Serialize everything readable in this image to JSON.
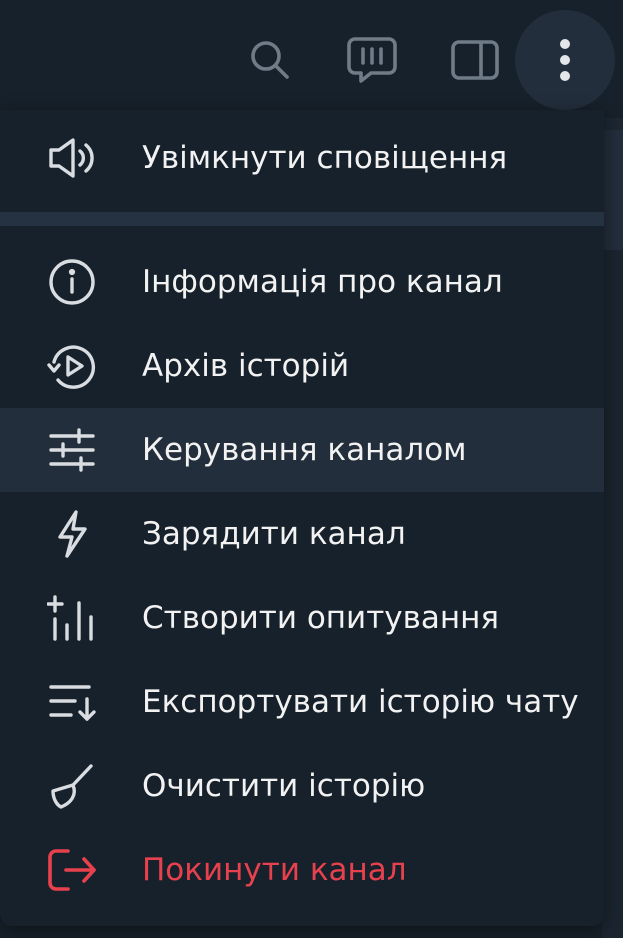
{
  "header": {
    "buttons": [
      {
        "id": "search",
        "icon": "search-icon"
      },
      {
        "id": "chat",
        "icon": "chat-icon"
      },
      {
        "id": "panel",
        "icon": "sidebar-toggle-icon"
      },
      {
        "id": "more",
        "icon": "more-vertical-icon"
      }
    ]
  },
  "menu": {
    "items": [
      {
        "label": "Увімкнути сповіщення",
        "icon": "speaker-icon"
      },
      {
        "label": "Інформація про канал",
        "icon": "info-icon"
      },
      {
        "label": "Архів історій",
        "icon": "stories-archive-icon"
      },
      {
        "label": "Керування каналом",
        "icon": "sliders-icon"
      },
      {
        "label": "Зарядити канал",
        "icon": "lightning-icon"
      },
      {
        "label": "Створити опитування",
        "icon": "poll-icon"
      },
      {
        "label": "Експортувати історію чату",
        "icon": "export-icon"
      },
      {
        "label": "Очистити історію",
        "icon": "broom-icon"
      },
      {
        "label": "Покинути канал",
        "icon": "leave-icon"
      }
    ]
  },
  "colors": {
    "background": "#17212b",
    "hover": "#232e3c",
    "text": "#f2f2f2",
    "icon": "#d9dde1",
    "danger": "#e8414e"
  }
}
